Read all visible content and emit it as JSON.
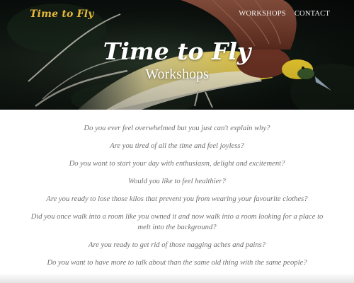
{
  "site": {
    "logo": "Time to Fly"
  },
  "nav": {
    "items": [
      {
        "label": "WORKSHOPS"
      },
      {
        "label": "CONTACT"
      }
    ]
  },
  "hero": {
    "title": "Time to Fly",
    "subtitle": "Workshops"
  },
  "questions": [
    "Do you ever feel overwhelmed but you just can't explain why?",
    "Are you tired of all the time and feel joyless?",
    "Do you want to start your day with enthusiasm, delight and excitement?",
    "Would you like to feel healthier?",
    "Are you ready to lose those kilos that prevent you from wearing your favourite clothes?",
    "Did you once walk into a room like you owned it and now walk into a room looking for a place to melt into the background?",
    "Are you ready to get rid of those nagging aches and pains?",
    "Do you want to have more to talk about than the same old thing with the same people?"
  ],
  "colors": {
    "logo_accent": "#e7b93a",
    "question_text": "#6f6f6f",
    "hero_dark": "#0d1410",
    "bird_yellow": "#e9c92e",
    "bird_brown": "#7a3c2c"
  }
}
